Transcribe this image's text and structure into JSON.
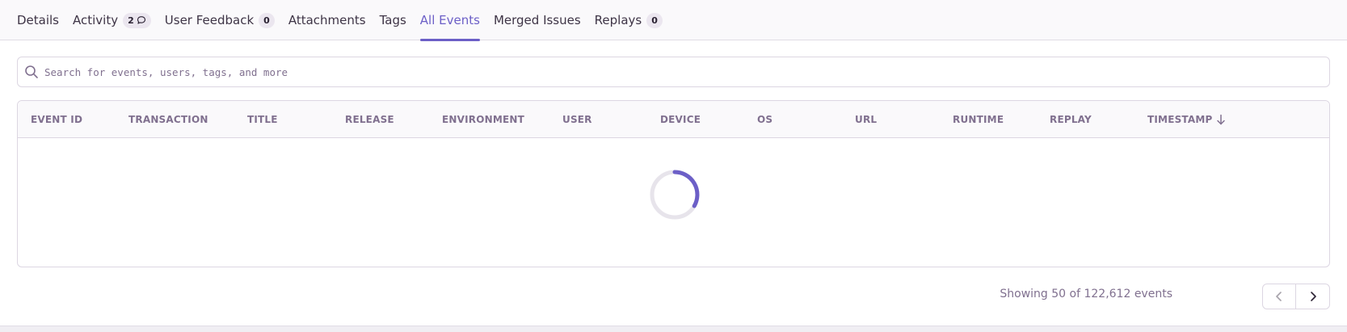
{
  "tabs": [
    {
      "label": "Details",
      "badge": null,
      "active": false
    },
    {
      "label": "Activity",
      "badge": "2",
      "active": false
    },
    {
      "label": "User Feedback",
      "badge": "0",
      "active": false
    },
    {
      "label": "Attachments",
      "badge": null,
      "active": false
    },
    {
      "label": "Tags",
      "badge": null,
      "active": false
    },
    {
      "label": "All Events",
      "badge": null,
      "active": true
    },
    {
      "label": "Merged Issues",
      "badge": null,
      "active": false
    },
    {
      "label": "Replays",
      "badge": "0",
      "active": false
    }
  ],
  "search": {
    "placeholder": "Search for events, users, tags, and more",
    "value": ""
  },
  "table": {
    "columns": [
      "EVENT ID",
      "TRANSACTION",
      "TITLE",
      "RELEASE",
      "ENVIRONMENT",
      "USER",
      "DEVICE",
      "OS",
      "URL",
      "RUNTIME",
      "REPLAY",
      "TIMESTAMP"
    ],
    "sorted_column": "TIMESTAMP",
    "sort_direction": "descending",
    "loading": true
  },
  "pagination": {
    "summary": "Showing 50 of 122,612 events"
  },
  "colors": {
    "accent": "#6c5fc7",
    "muted_text": "#80708f",
    "border": "#dcd6e2"
  },
  "icons": {
    "activity_badge": "comment-icon",
    "search": "search-icon",
    "sort": "arrow-down-icon",
    "prev": "chevron-left-icon",
    "next": "chevron-right-icon",
    "loading": "spinner-icon"
  }
}
